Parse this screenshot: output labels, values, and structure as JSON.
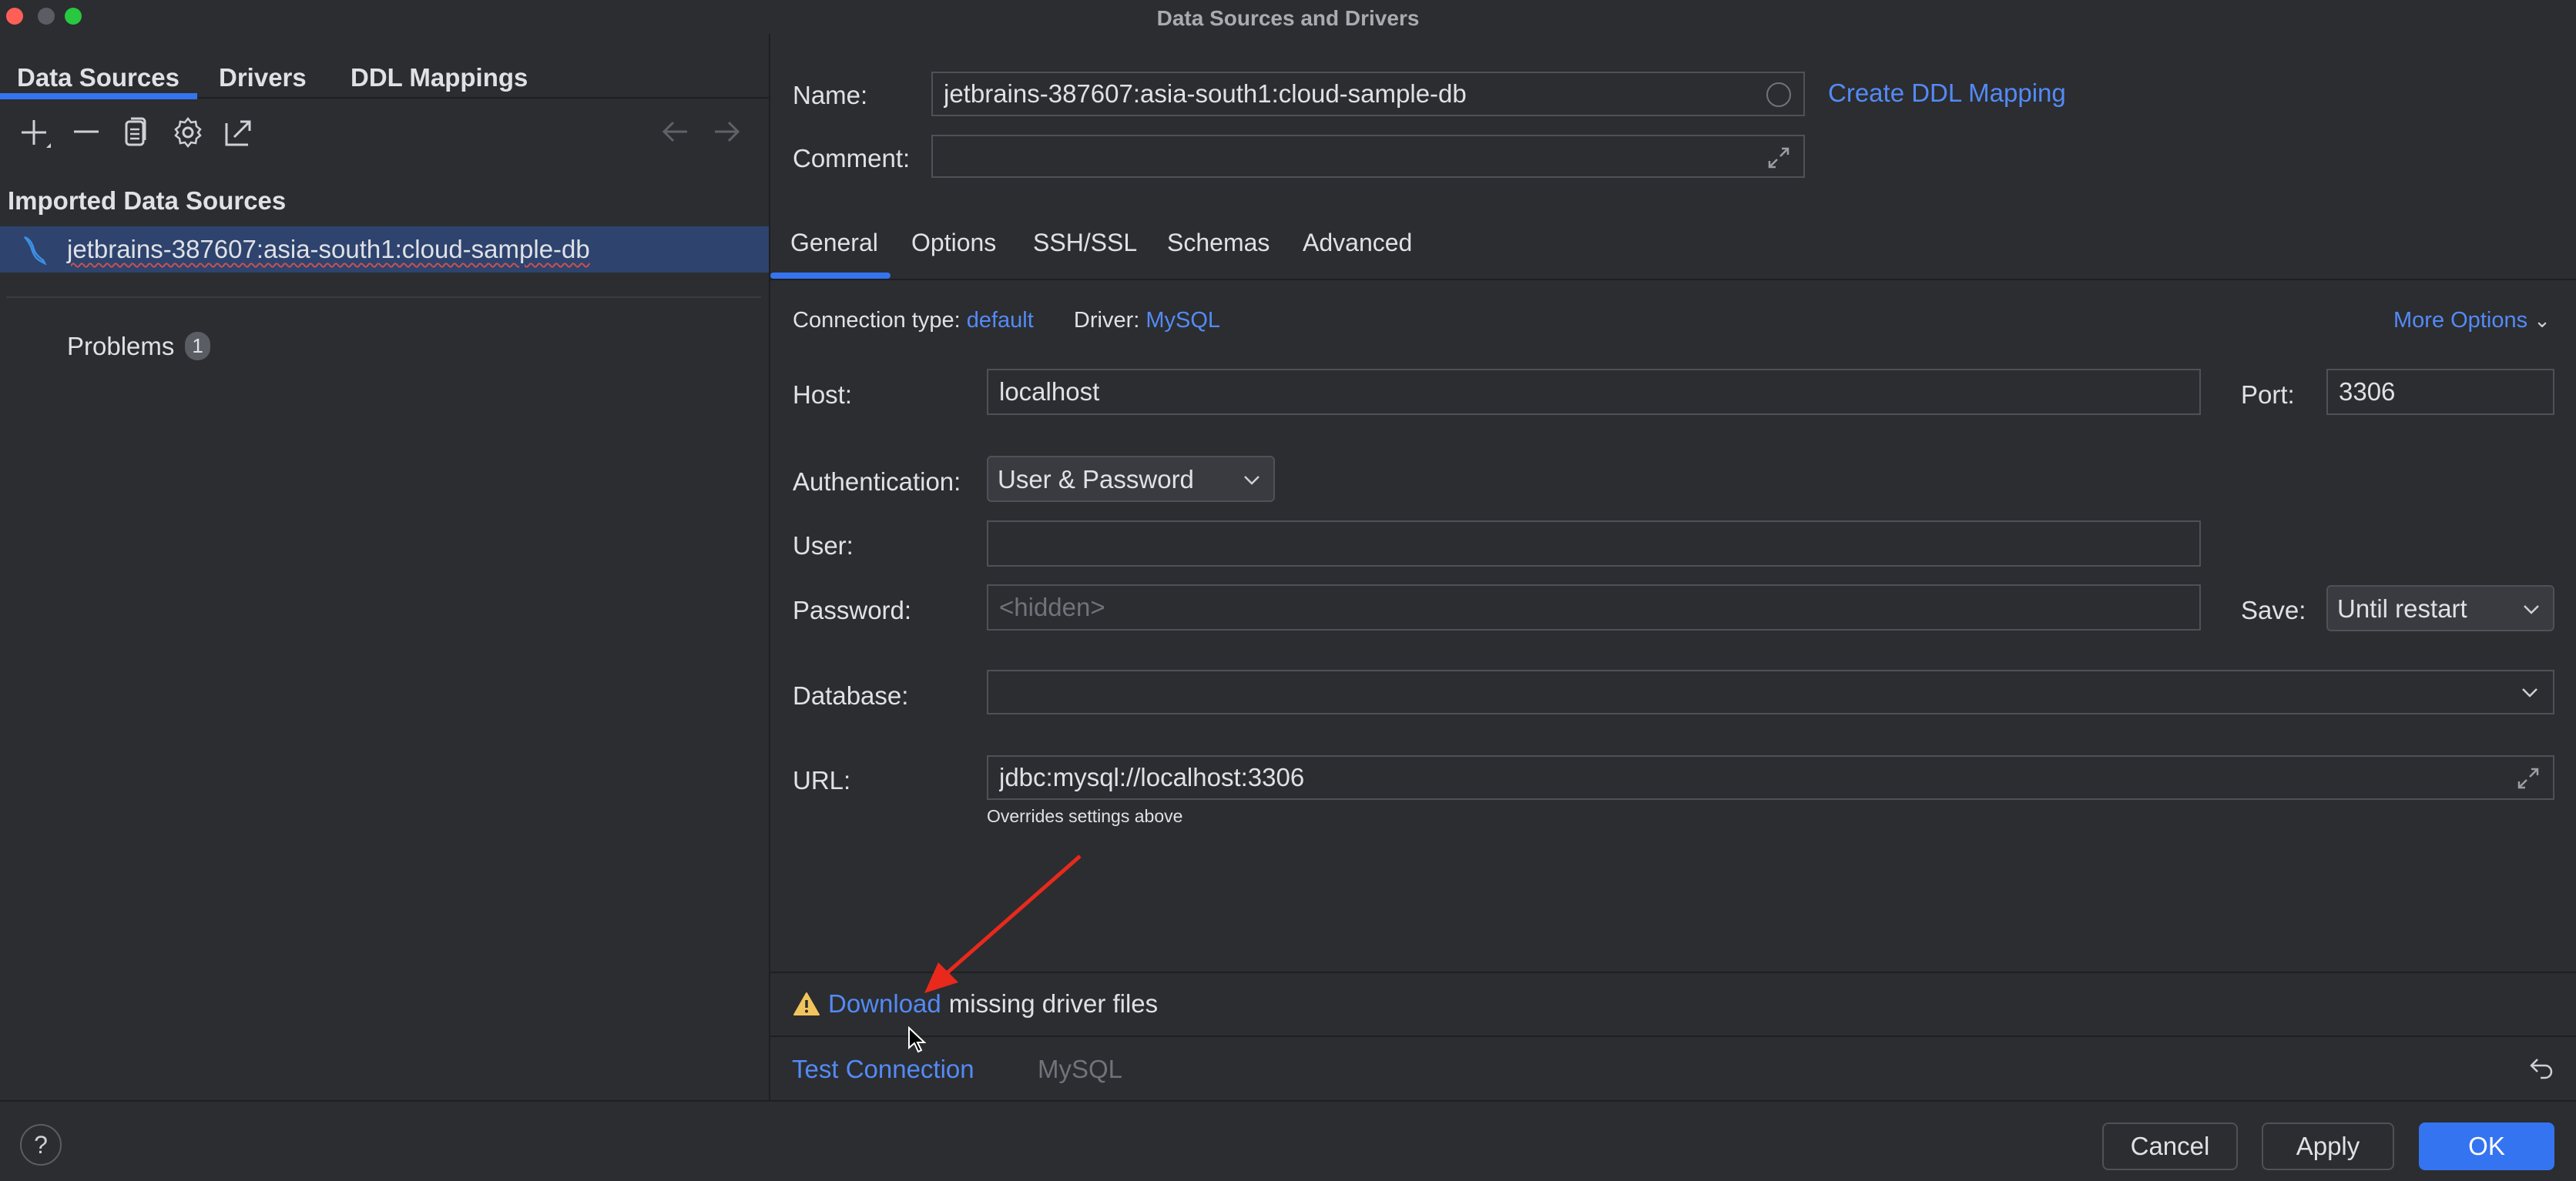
{
  "window": {
    "title": "Data Sources and Drivers",
    "traffic_lights": {
      "close": "#ff5f57",
      "minimize": "#5a5d63",
      "maximize": "#28c840"
    }
  },
  "left_panel": {
    "tabs": [
      {
        "label": "Data Sources",
        "active": true
      },
      {
        "label": "Drivers",
        "active": false
      },
      {
        "label": "DDL Mappings",
        "active": false
      }
    ],
    "toolbar": {
      "add_icon": "plus-icon",
      "remove_icon": "minus-icon",
      "duplicate_icon": "copy-icon",
      "settings_icon": "gear-icon",
      "export_icon": "export-icon",
      "back_icon": "arrow-left-icon",
      "forward_icon": "arrow-right-icon"
    },
    "section_title": "Imported Data Sources",
    "items": [
      {
        "label": "jetbrains-387607:asia-south1:cloud-sample-db",
        "icon": "mysql-dolphin-icon",
        "selected": true
      }
    ],
    "problems": {
      "label": "Problems",
      "count": "1"
    }
  },
  "right_panel": {
    "name": {
      "label": "Name:",
      "value": "jetbrains-387607:asia-south1:cloud-sample-db"
    },
    "comment": {
      "label": "Comment:",
      "value": ""
    },
    "create_ddl_mapping": "Create DDL Mapping",
    "tabs": [
      {
        "label": "General",
        "active": true
      },
      {
        "label": "Options",
        "active": false
      },
      {
        "label": "SSH/SSL",
        "active": false
      },
      {
        "label": "Schemas",
        "active": false
      },
      {
        "label": "Advanced",
        "active": false
      }
    ],
    "connection_type": {
      "label": "Connection type:",
      "value": "default"
    },
    "driver": {
      "label": "Driver:",
      "value": "MySQL"
    },
    "more_options": "More Options",
    "host": {
      "label": "Host:",
      "value": "localhost"
    },
    "port": {
      "label": "Port:",
      "value": "3306"
    },
    "authentication": {
      "label": "Authentication:",
      "value": "User & Password"
    },
    "user": {
      "label": "User:",
      "value": ""
    },
    "password": {
      "label": "Password:",
      "placeholder": "<hidden>"
    },
    "save": {
      "label": "Save:",
      "value": "Until restart"
    },
    "database": {
      "label": "Database:",
      "value": ""
    },
    "url": {
      "label": "URL:",
      "value": "jdbc:mysql://localhost:3306",
      "hint": "Overrides settings above"
    },
    "warning": {
      "link": "Download",
      "text": "missing driver files",
      "icon_color": "#f2c55c"
    },
    "test_connection": "Test Connection",
    "driver_status": "MySQL"
  },
  "footer": {
    "help": "?",
    "cancel": "Cancel",
    "apply": "Apply",
    "ok": "OK"
  },
  "annotation": {
    "arrow_color": "#e8291c"
  }
}
